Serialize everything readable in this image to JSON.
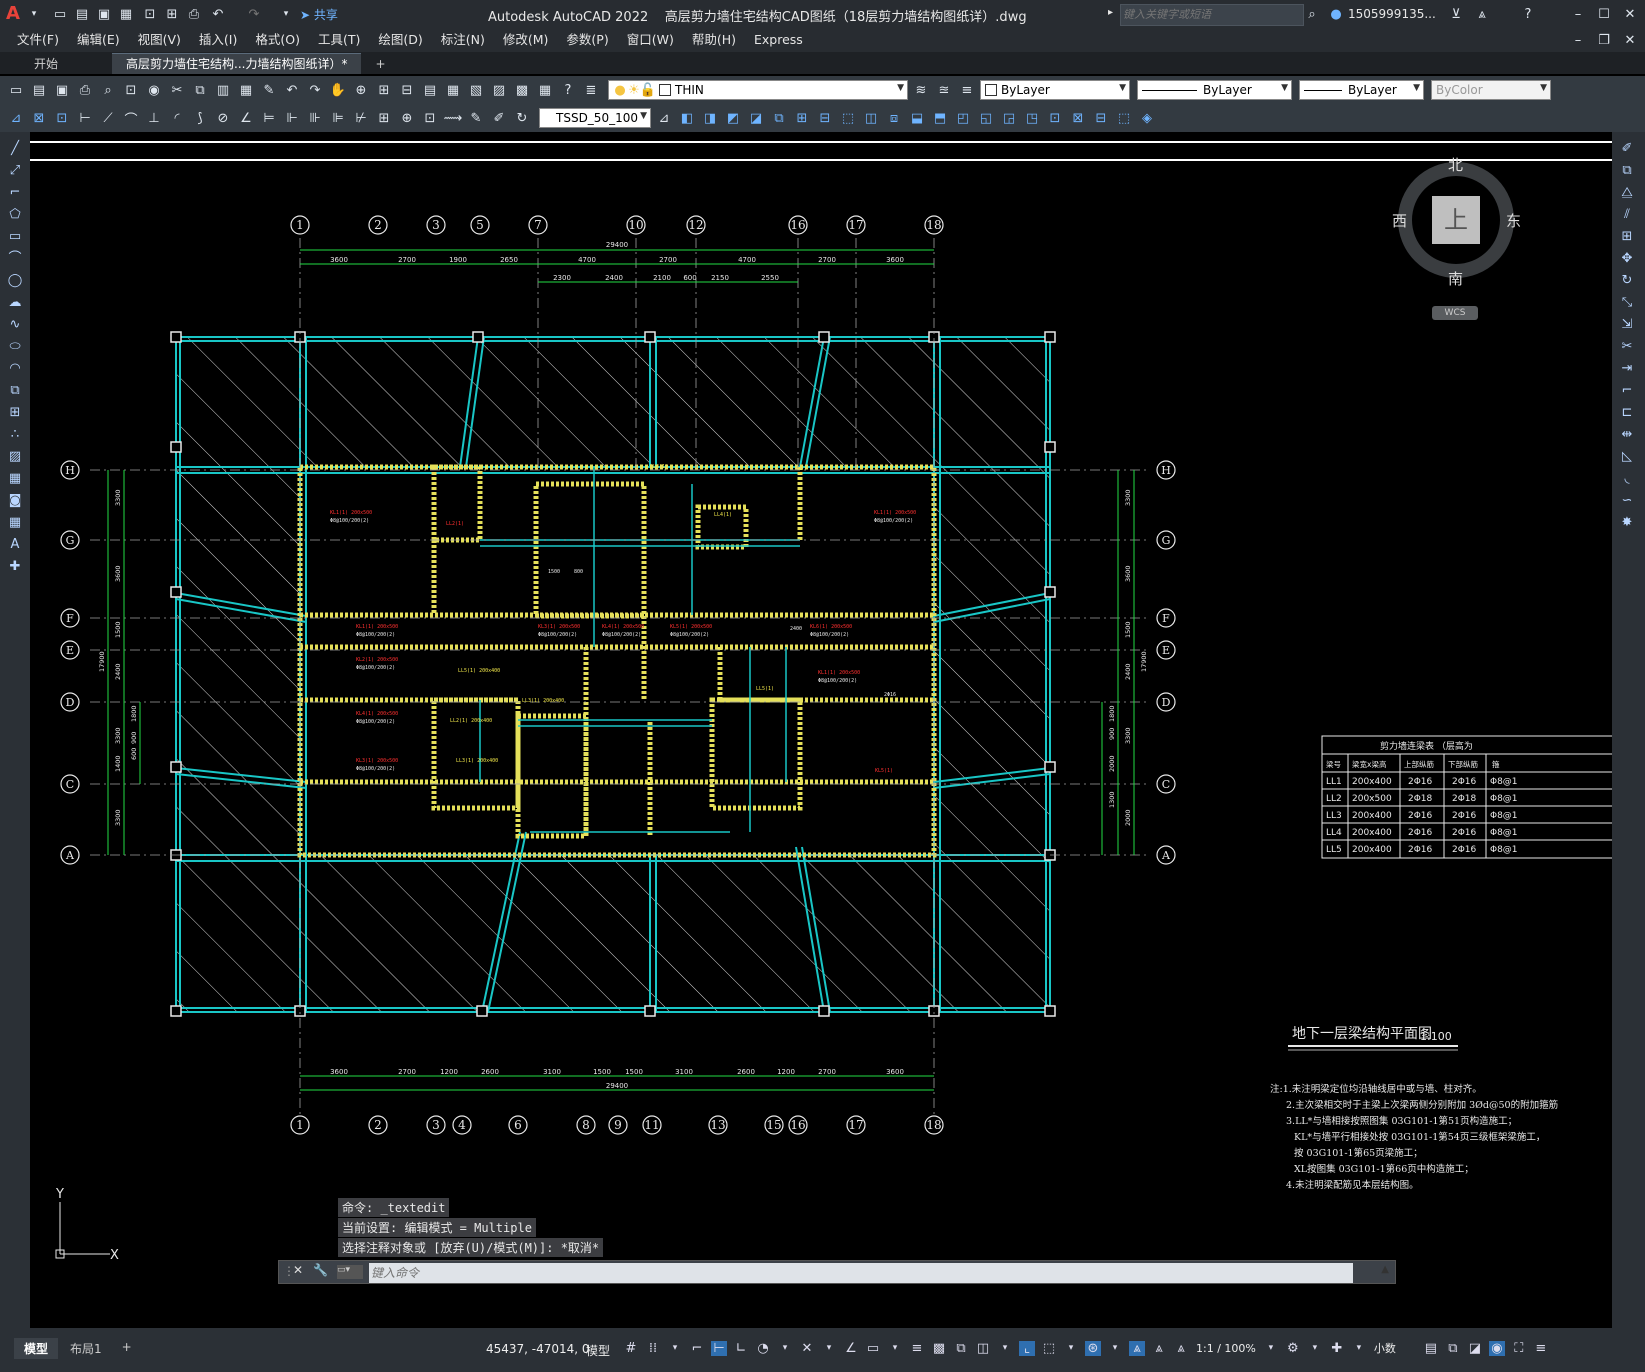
{
  "app": {
    "title": "Autodesk AutoCAD 2022",
    "file": "高层剪力墙住宅结构CAD图纸（18层剪力墙结构图纸详）.dwg",
    "search_placeholder": "键入关键字或短语",
    "user": "1505999135...",
    "share": "共享"
  },
  "menu": [
    "文件(F)",
    "编辑(E)",
    "视图(V)",
    "插入(I)",
    "格式(O)",
    "工具(T)",
    "绘图(D)",
    "标注(N)",
    "修改(M)",
    "参数(P)",
    "窗口(W)",
    "帮助(H)",
    "Express"
  ],
  "tabs": [
    {
      "label": "开始"
    },
    {
      "label": "高层剪力墙住宅结构...力墙结构图纸详）*"
    }
  ],
  "properties": {
    "layer": "THIN",
    "color": "ByLayer",
    "linetype": "ByLayer",
    "lineweight": "ByLayer",
    "plotstyle": "ByColor",
    "dimstyle": "TSSD_50_100"
  },
  "viewcube": {
    "north": "北",
    "south": "南",
    "east": "东",
    "west": "西",
    "top": "上",
    "wcs": "WCS"
  },
  "drawing": {
    "top_axes": [
      "1",
      "2",
      "3",
      "5",
      "7",
      "10",
      "12",
      "16",
      "17",
      "18"
    ],
    "bottom_axes": [
      "1",
      "2",
      "3",
      "4",
      "6",
      "8",
      "9",
      "11",
      "13",
      "15",
      "16",
      "17",
      "18"
    ],
    "row_axes": [
      "H",
      "G",
      "F",
      "E",
      "D",
      "C",
      "A"
    ],
    "top_total": "29400",
    "bottom_total": "29400",
    "top_dims": [
      "3600",
      "2700",
      "1900",
      "2650",
      "4700",
      "2700",
      "4700",
      "2700",
      "3600"
    ],
    "top_dims2": [
      "2300",
      "2400",
      "2100",
      "600",
      "2150",
      "2550"
    ],
    "bottom_dims": [
      "3600",
      "2700",
      "1200",
      "2600",
      "3100",
      "1500",
      "1500",
      "3100",
      "2600",
      "1200",
      "2700",
      "3600"
    ],
    "side_total": "17900",
    "left_dims": [
      "3300",
      "3600",
      "1500",
      "2400",
      "1800",
      "900",
      "3300",
      "600",
      "1400",
      "3300"
    ],
    "right_dims": [
      "3300",
      "3600",
      "1500",
      "2400",
      "1800",
      "900",
      "2000",
      "1300",
      "3300",
      "2000"
    ],
    "plan_title": "地下一层梁结构平面图",
    "plan_scale": "1:100",
    "notes": [
      "注:1.未注明梁定位均沿轴线居中或与墙、柱对齐。",
      "2.主次梁相交时于主梁上次梁两侧分别附加 3Ød@50的附加箍筋",
      "3.LL*与墙相接按照图集 03G101-1第51页构造施工；",
      "KL*与墙平行相接处按 03G101-1第54页三级框架梁施工，",
      "按 03G101-1第65页梁施工；",
      "XL按图集 03G101-1第66页中构造施工；",
      "4.未注明梁配筋见本层结构图。"
    ],
    "table": {
      "title": "剪力墙连梁表 （层高为",
      "headers": [
        "梁号",
        "梁宽x梁高",
        "上部纵筋",
        "下部纵筋",
        "箍"
      ],
      "rows": [
        [
          "LL1",
          "200x400",
          "2Φ16",
          "2Φ16",
          "Φ8@1"
        ],
        [
          "LL2",
          "200x500",
          "2Φ18",
          "2Φ18",
          "Φ8@1"
        ],
        [
          "LL3",
          "200x400",
          "2Φ16",
          "2Φ16",
          "Φ8@1"
        ],
        [
          "LL4",
          "200x400",
          "2Φ16",
          "2Φ16",
          "Φ8@1"
        ],
        [
          "LL5",
          "200x400",
          "2Φ16",
          "2Φ16",
          "Φ8@1"
        ]
      ]
    }
  },
  "command": {
    "history": [
      "命令: _textedit",
      "当前设置: 编辑模式 = Multiple",
      "选择注释对象或 [放弃(U)/模式(M)]: *取消*"
    ],
    "placeholder": "键入命令"
  },
  "status": {
    "coords": "45437, -47014, 0",
    "space": "模型",
    "layout_tabs": [
      "模型",
      "布局1"
    ],
    "scale": "1:1 / 100%",
    "units": "小数"
  },
  "ucs": {
    "y": "Y",
    "x": "X"
  }
}
